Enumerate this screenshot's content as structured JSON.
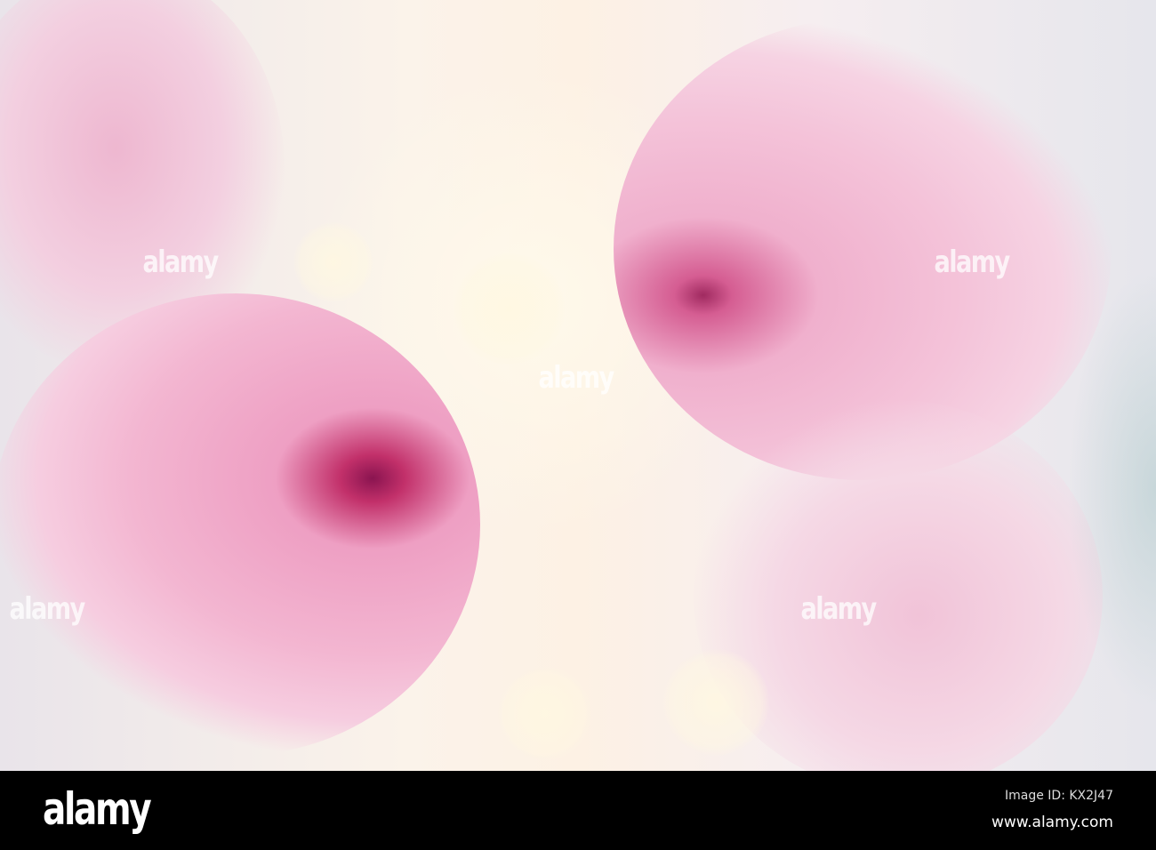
{
  "watermark_text": "alamy",
  "footer": {
    "logo": "alamy",
    "image_id": "Image ID: KX2J47",
    "url": "www.alamy.com"
  },
  "colors": {
    "petal_pink": "#f2a9c8",
    "deep_pink": "#c2306a",
    "background_cream": "#fbf3ea",
    "footer_bg": "#000000"
  }
}
